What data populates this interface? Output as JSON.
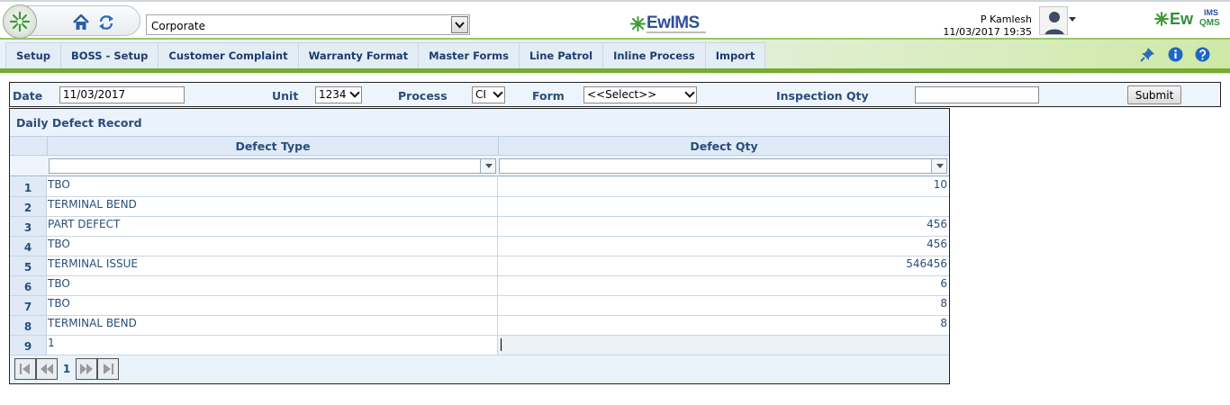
{
  "header": {
    "company_select_value": "Corporate",
    "center_logo_text": "EwIMS",
    "user_name": "P Kamlesh",
    "user_datetime": "11/03/2017 19:35",
    "right_logo_ew": "Ew",
    "right_logo_ims": "IMS",
    "right_logo_qms": "QMS",
    "icons": [
      "app-logo-icon",
      "home-icon",
      "refresh-icon",
      "user-avatar-icon",
      "pin-icon",
      "info-icon",
      "help-icon"
    ]
  },
  "menu": {
    "items": [
      "Setup",
      "BOSS - Setup",
      "Customer Complaint",
      "Warranty Format",
      "Master Forms",
      "Line Patrol",
      "Inline Process",
      "Import"
    ]
  },
  "filters": {
    "date_label": "Date",
    "date_value": "11/03/2017",
    "unit_label": "Unit",
    "unit_value": "1234",
    "process_label": "Process",
    "process_value": "CI",
    "form_label": "Form",
    "form_value": "<<Select>>",
    "inspection_qty_label": "Inspection Qty",
    "inspection_qty_value": "",
    "submit_label": "Submit"
  },
  "grid": {
    "title": "Daily Defect Record",
    "columns": [
      "Defect Type",
      "Defect Qty"
    ],
    "rows": [
      {
        "num": "1",
        "type": "TBO",
        "qty": "10"
      },
      {
        "num": "2",
        "type": "TERMINAL BEND",
        "qty": ""
      },
      {
        "num": "3",
        "type": "PART DEFECT",
        "qty": "456"
      },
      {
        "num": "4",
        "type": "TBO",
        "qty": "456"
      },
      {
        "num": "5",
        "type": "TERMINAL ISSUE",
        "qty": "546456"
      },
      {
        "num": "6",
        "type": "TBO",
        "qty": "6"
      },
      {
        "num": "7",
        "type": "TBO",
        "qty": "8"
      },
      {
        "num": "8",
        "type": "TERMINAL BEND",
        "qty": "8"
      },
      {
        "num": "9",
        "type": "1",
        "qty": ""
      }
    ],
    "pager_page": "1"
  },
  "colors": {
    "label_blue": "#2a4d7a",
    "menu_green": "#74ad2f",
    "grid_bg": "#eaf2fb"
  }
}
